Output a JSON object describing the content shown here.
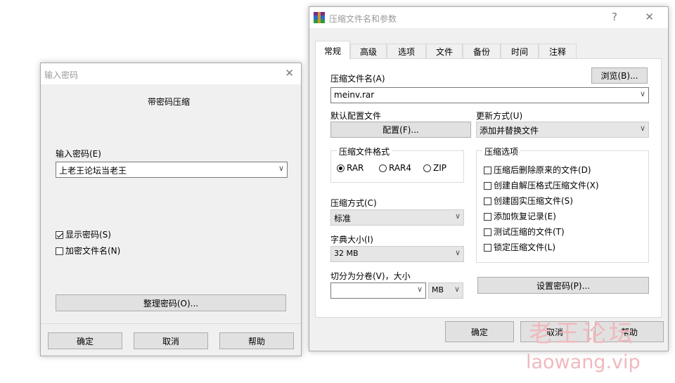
{
  "password_dialog": {
    "title": "输入密码",
    "header": "带密码压缩",
    "password_label": "输入密码(E)",
    "password_value": "上老王论坛当老王",
    "show_password_label": "显示密码(S)",
    "show_password_checked": true,
    "encrypt_filenames_label": "加密文件名(N)",
    "encrypt_filenames_checked": false,
    "organize_button": "整理密码(O)...",
    "ok_button": "确定",
    "cancel_button": "取消",
    "help_button": "帮助"
  },
  "archive_dialog": {
    "title": "压缩文件名和参数",
    "help_glyph": "?",
    "close_glyph": "✕",
    "tabs": [
      {
        "label": "常规",
        "active": true
      },
      {
        "label": "高级",
        "active": false
      },
      {
        "label": "选项",
        "active": false
      },
      {
        "label": "文件",
        "active": false
      },
      {
        "label": "备份",
        "active": false
      },
      {
        "label": "时间",
        "active": false
      },
      {
        "label": "注释",
        "active": false
      }
    ],
    "archive_name_label": "压缩文件名(A)",
    "browse_button": "浏览(B)...",
    "archive_name_value": "meinv.rar",
    "default_profile_label": "默认配置文件",
    "profile_button": "配置(F)...",
    "update_mode_label": "更新方式(U)",
    "update_mode_value": "添加并替换文件",
    "format_group_title": "压缩文件格式",
    "formats": [
      {
        "label": "RAR",
        "selected": true
      },
      {
        "label": "RAR4",
        "selected": false
      },
      {
        "label": "ZIP",
        "selected": false
      }
    ],
    "method_label": "压缩方式(C)",
    "method_value": "标准",
    "dict_label": "字典大小(I)",
    "dict_value": "32 MB",
    "split_label": "切分为分卷(V)，大小",
    "split_value": "",
    "split_unit": "MB",
    "options_group_title": "压缩选项",
    "options": [
      {
        "label": "压缩后删除原来的文件(D)",
        "checked": false
      },
      {
        "label": "创建自解压格式压缩文件(X)",
        "checked": false
      },
      {
        "label": "创建固实压缩文件(S)",
        "checked": false
      },
      {
        "label": "添加恢复记录(E)",
        "checked": false
      },
      {
        "label": "测试压缩的文件(T)",
        "checked": false
      },
      {
        "label": "锁定压缩文件(L)",
        "checked": false
      }
    ],
    "set_password_button": "设置密码(P)...",
    "ok_button": "确定",
    "cancel_button": "取消",
    "help_button": "帮助"
  },
  "watermark": {
    "cn": "老王论坛",
    "url": "laowang.vip"
  },
  "colors": {
    "watermark": "#f0b9bd",
    "dialog_bg": "#f0f0f0",
    "button_bg": "#e1e1e1"
  }
}
